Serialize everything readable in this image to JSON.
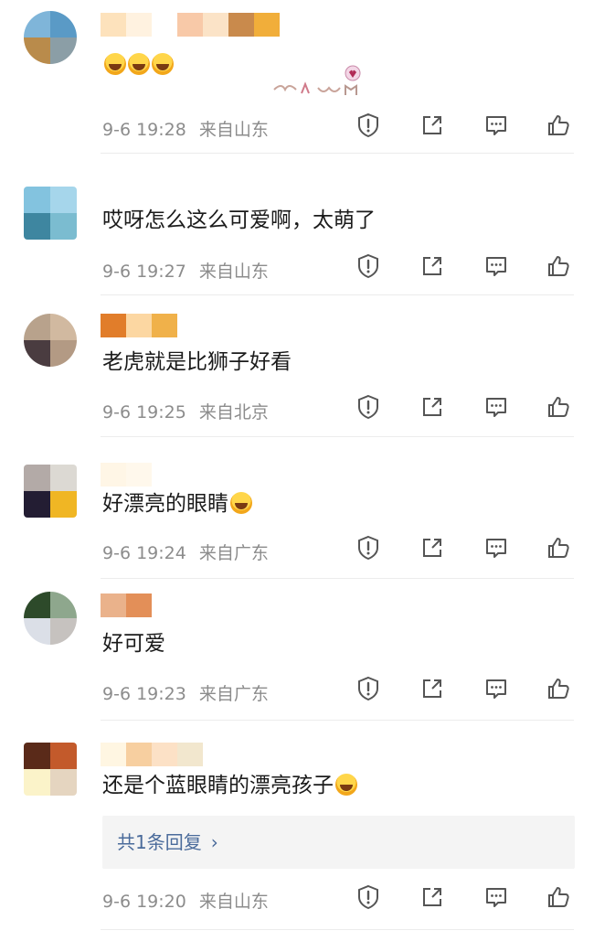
{
  "comments": [
    {
      "avatar_colors": [
        "#7fb5d9",
        "#5a9ac6",
        "#b98b4b",
        "#8b9ea6"
      ],
      "name_colors": [
        "#fde2bc",
        "#fff2e0",
        "#ffffff",
        "#f8c9a8",
        "#fbe3c7",
        "#c98a4c",
        "#f1ae3a"
      ],
      "text": "",
      "emoji_count": 3,
      "has_sticker": true,
      "time": "9-6 19:28",
      "location": "来自山东"
    },
    {
      "avatar_colors": [
        "#83c3df",
        "#a6d6eb",
        "#3e86a0",
        "#7bbcd0"
      ],
      "name_colors": [
        "#ffffff",
        "#ffffff",
        "#ffffff"
      ],
      "text": "哎呀怎么这么可爱啊，太萌了",
      "time": "9-6 19:27",
      "location": "来自山东"
    },
    {
      "avatar_colors": [
        "#b8a28c",
        "#d1b9a0",
        "#4a3c40",
        "#b39a84"
      ],
      "name_colors": [
        "#e17d2a",
        "#fcd7a2",
        "#f0b14a"
      ],
      "text": "老虎就是比狮子好看",
      "time": "9-6 19:25",
      "location": "来自北京"
    },
    {
      "avatar_colors": [
        "#b3aaa7",
        "#dcd9d3",
        "#231d33",
        "#f0b624"
      ],
      "name_colors": [
        "#fff6e6",
        "#fff8ec"
      ],
      "text": "好漂亮的眼睛",
      "emoji_count": 1,
      "time": "9-6 19:24",
      "location": "来自广东"
    },
    {
      "avatar_colors": [
        "#2d4a2a",
        "#8ea78d",
        "#dbdfe7",
        "#c6c2bf"
      ],
      "name_colors": [
        "#eab28b",
        "#e38f58"
      ],
      "text": "好可爱",
      "time": "9-6 19:23",
      "location": "来自广东"
    },
    {
      "avatar_colors": [
        "#5a2a19",
        "#c35a2b",
        "#fbf3c9",
        "#e5d5c0"
      ],
      "name_colors": [
        "#fff6e2",
        "#f7cfa0",
        "#fce1c6",
        "#f2e7ce"
      ],
      "text": "还是个蓝眼睛的漂亮孩子",
      "emoji_count": 1,
      "reply_label": "共1条回复",
      "time": "9-6 19:20",
      "location": "来自山东"
    }
  ],
  "icons": [
    "report-icon",
    "share-icon",
    "comment-icon",
    "like-icon"
  ],
  "colors": {
    "meta": "#8c8c8c",
    "reply_link": "#4a6b9b",
    "icon": "#555555"
  }
}
